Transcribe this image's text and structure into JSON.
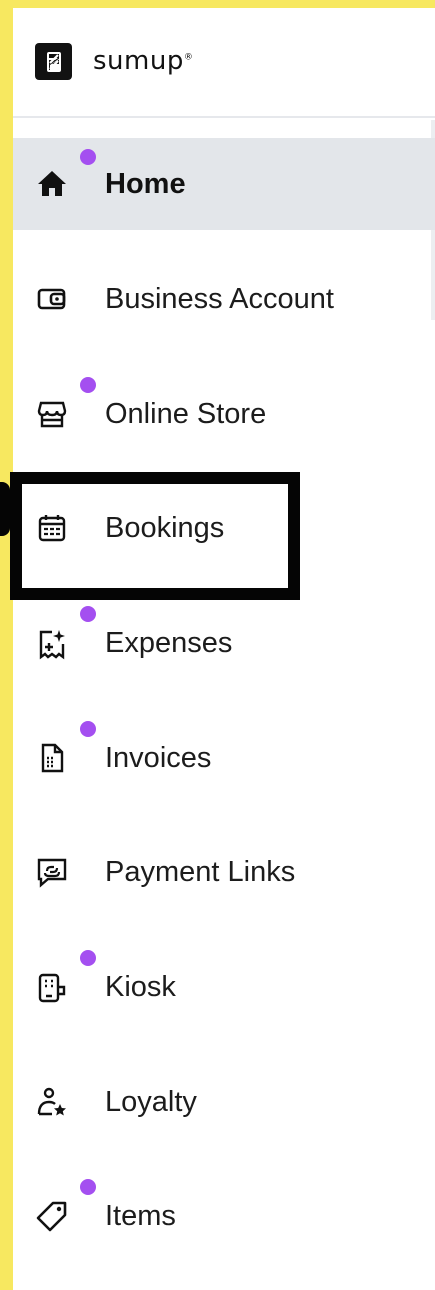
{
  "brand": {
    "name": "sumup",
    "mark": "®"
  },
  "nav": {
    "items": [
      {
        "key": "home",
        "label": "Home",
        "icon": "home-icon",
        "active": true,
        "dot": true
      },
      {
        "key": "business-account",
        "label": "Business Account",
        "icon": "wallet-icon",
        "active": false,
        "dot": false
      },
      {
        "key": "online-store",
        "label": "Online Store",
        "icon": "storefront-icon",
        "active": false,
        "dot": true
      },
      {
        "key": "bookings",
        "label": "Bookings",
        "icon": "calendar-icon",
        "active": false,
        "dot": false
      },
      {
        "key": "expenses",
        "label": "Expenses",
        "icon": "receipt-sparkle-icon",
        "active": false,
        "dot": true
      },
      {
        "key": "invoices",
        "label": "Invoices",
        "icon": "invoice-icon",
        "active": false,
        "dot": true
      },
      {
        "key": "payment-links",
        "label": "Payment Links",
        "icon": "chat-link-icon",
        "active": false,
        "dot": false
      },
      {
        "key": "kiosk",
        "label": "Kiosk",
        "icon": "kiosk-icon",
        "active": false,
        "dot": true
      },
      {
        "key": "loyalty",
        "label": "Loyalty",
        "icon": "loyalty-icon",
        "active": false,
        "dot": false
      },
      {
        "key": "items",
        "label": "Items",
        "icon": "tag-icon",
        "active": false,
        "dot": true
      }
    ]
  },
  "colors": {
    "background": "#f7e860",
    "active_row": "#e3e6ea",
    "badge_dot": "#a44ff0",
    "highlight_border": "#050505"
  }
}
